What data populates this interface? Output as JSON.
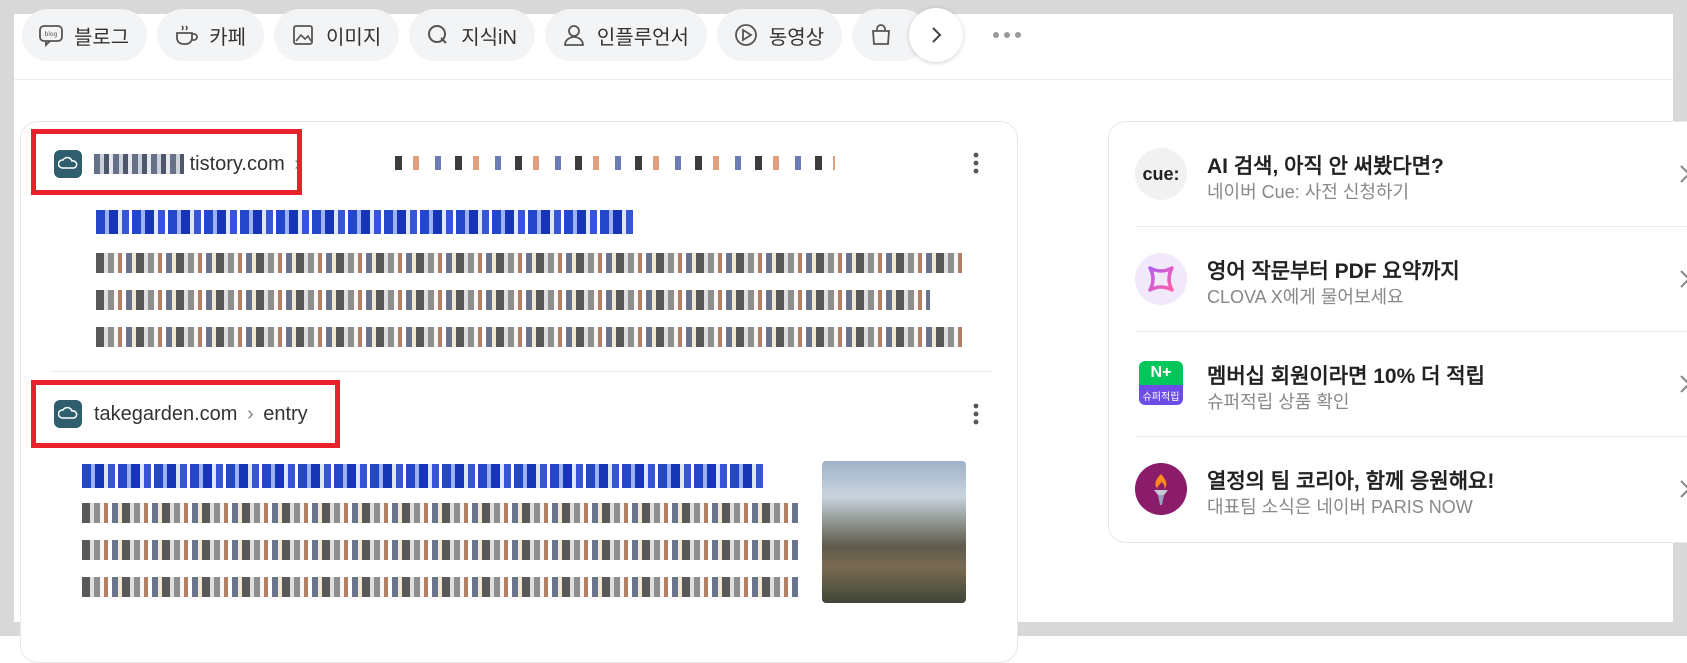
{
  "tabs": [
    {
      "label": "블로그",
      "icon": "blog-icon"
    },
    {
      "label": "카페",
      "icon": "cafe-icon"
    },
    {
      "label": "이미지",
      "icon": "image-icon"
    },
    {
      "label": "지식iN",
      "icon": "kin-icon"
    },
    {
      "label": "인플루언서",
      "icon": "influencer-icon"
    },
    {
      "label": "동영상",
      "icon": "video-icon"
    }
  ],
  "results": [
    {
      "domain": "tistory.com",
      "separator": "›",
      "path": ""
    },
    {
      "domain": "takegarden.com",
      "separator": "›",
      "path": "entry"
    }
  ],
  "promos": [
    {
      "title": "AI 검색, 아직 안 써봤다면?",
      "subtitle": "네이버 Cue: 사전 신청하기",
      "icon": "cue-logo-icon",
      "icon_text": "cue:"
    },
    {
      "title": "영어 작문부터 PDF 요약까지",
      "subtitle": "CLOVA X에게 물어보세요",
      "icon": "clova-x-icon"
    },
    {
      "title": "멤버십 회원이라면 10% 더 적립",
      "subtitle": "슈퍼적립 상품 확인",
      "icon": "naver-plus-icon",
      "icon_text": "N+",
      "icon_label": "슈퍼적립"
    },
    {
      "title": "열정의 팀 코리아, 함께 응원해요!",
      "subtitle": "대표팀 소식은 네이버 PARIS NOW",
      "icon": "torch-icon"
    }
  ],
  "colors": {
    "highlight": "#e8212b",
    "link": "#2446c9",
    "tab_bg": "#f3f4f6"
  }
}
